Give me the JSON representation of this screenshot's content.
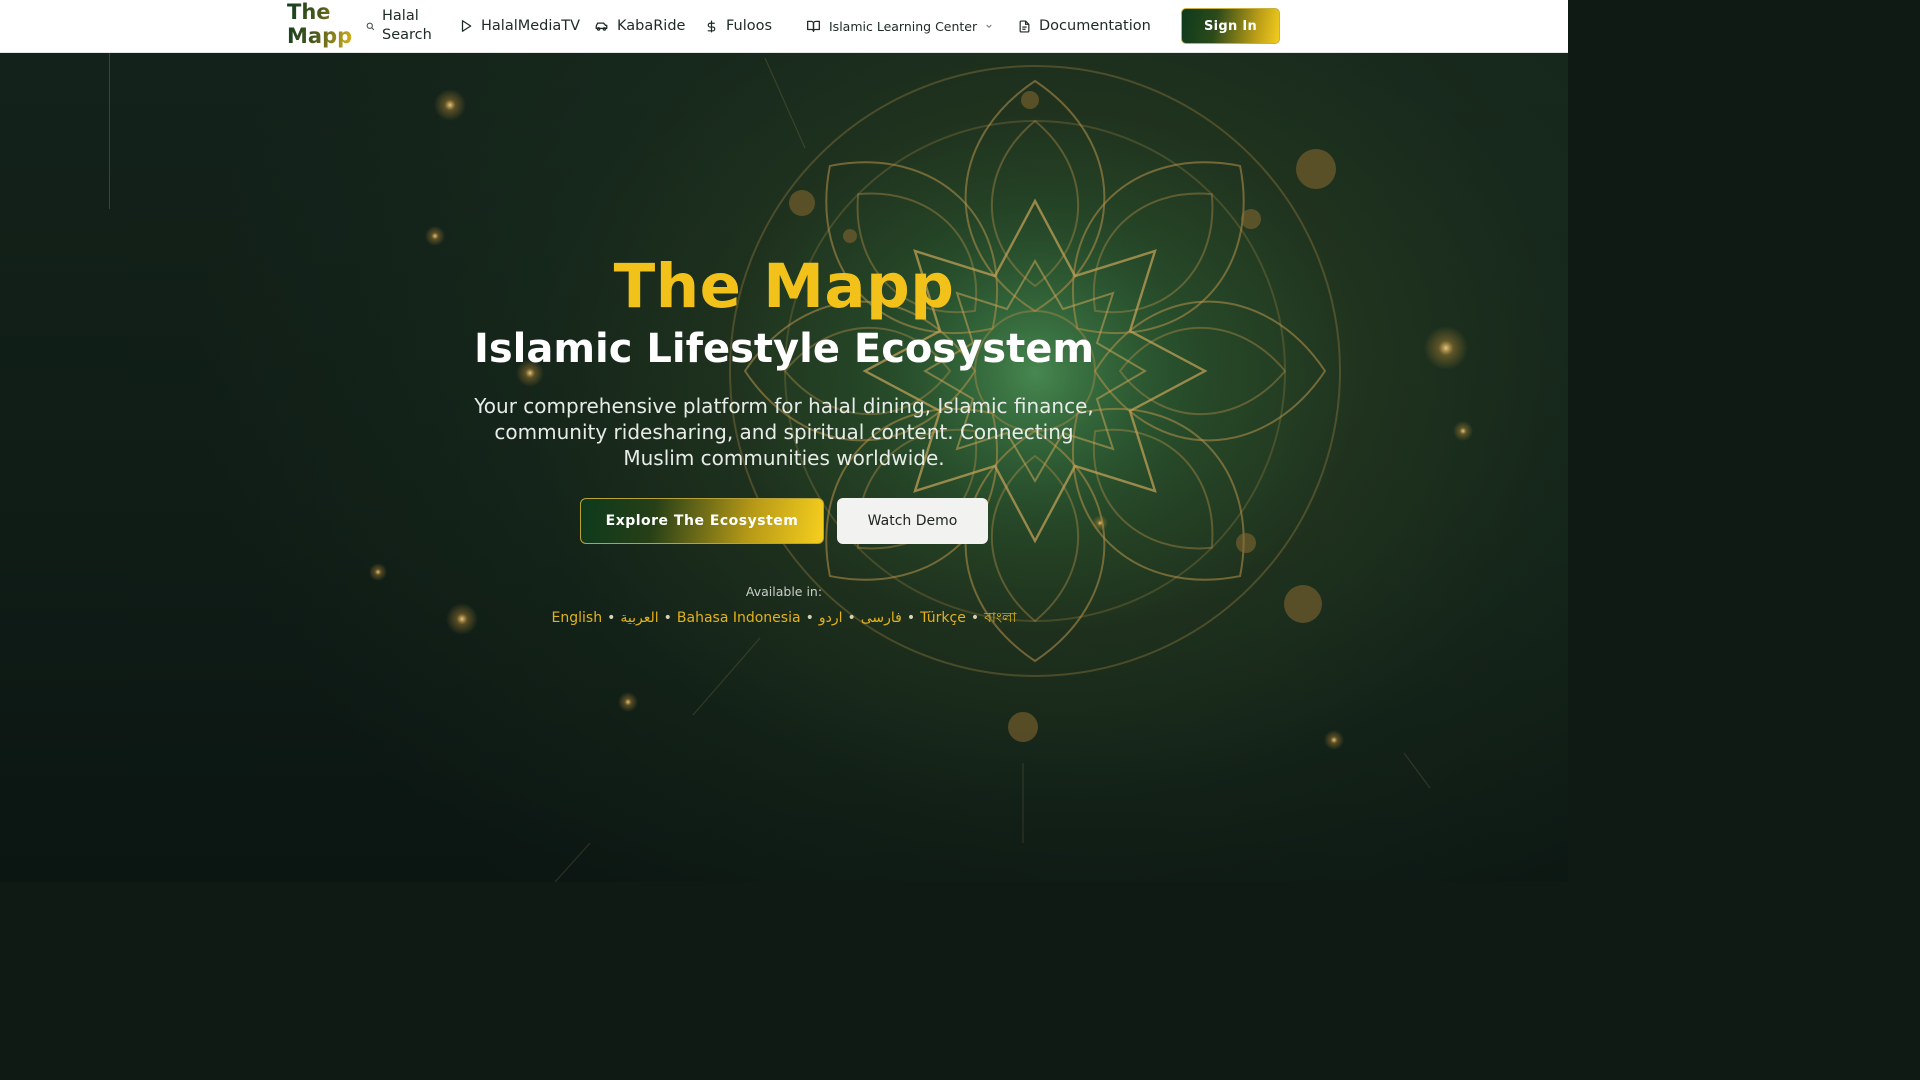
{
  "header": {
    "logo": "The Mapp",
    "nav": [
      {
        "label": "Halal Search",
        "icon": "search-icon"
      },
      {
        "label": "HalalMediaTV",
        "icon": "play-icon"
      },
      {
        "label": "KabaRide",
        "icon": "car-icon"
      },
      {
        "label": "Fuloos",
        "icon": "dollar-icon"
      },
      {
        "label": "Islamic Learning Center",
        "icon": "book-icon",
        "dropdown": true
      },
      {
        "label": "Documentation",
        "icon": "document-icon"
      }
    ],
    "sign_in": "Sign In"
  },
  "hero": {
    "title": "The Mapp",
    "subtitle": "Islamic Lifestyle Ecosystem",
    "description": "Your comprehensive platform for halal dining, Islamic finance, community ridesharing, and spiritual content. Connecting Muslim communities worldwide.",
    "primary_cta": "Explore The Ecosystem",
    "secondary_cta": "Watch Demo",
    "available_label": "Available in:",
    "languages": [
      "English",
      "العربية",
      "Bahasa Indonesia",
      "فارسی",
      "اردو",
      "Türkçe",
      "বাংলা"
    ],
    "language_separator": "•"
  },
  "colors": {
    "accent_gold": "#f3c21a",
    "brand_green": "#0d3a1c",
    "background": "#0f1a14"
  }
}
